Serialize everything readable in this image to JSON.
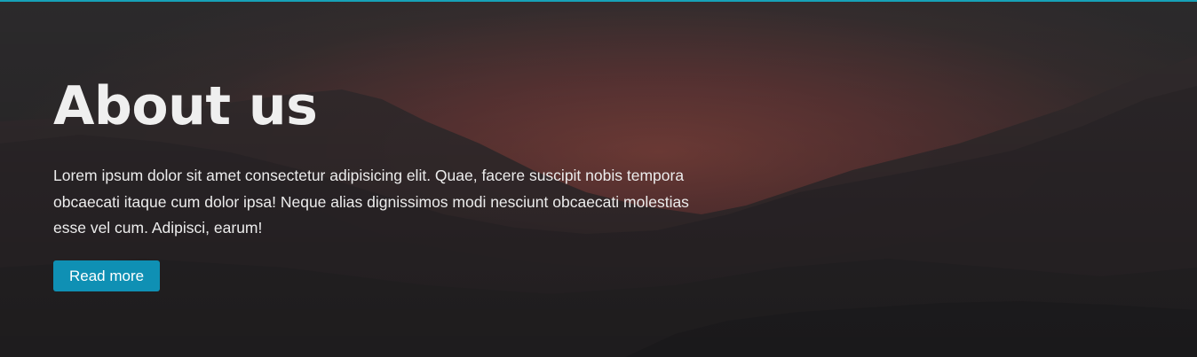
{
  "colors": {
    "accent": "#0f90b4",
    "top_border": "#17a2b8",
    "background_dark": "#2b2a2c",
    "sky_glow": "#8a4a44"
  },
  "hero": {
    "background_image": "mountain-sunset-image",
    "title": "About us",
    "text": "Lorem ipsum dolor sit amet consectetur adipisicing elit. Quae, facere suscipit nobis tempora obcaecati itaque cum dolor ipsa! Neque alias dignissimos modi nesciunt obcaecati molestias esse vel cum. Adipisci, earum!",
    "button_label": "Read more"
  }
}
